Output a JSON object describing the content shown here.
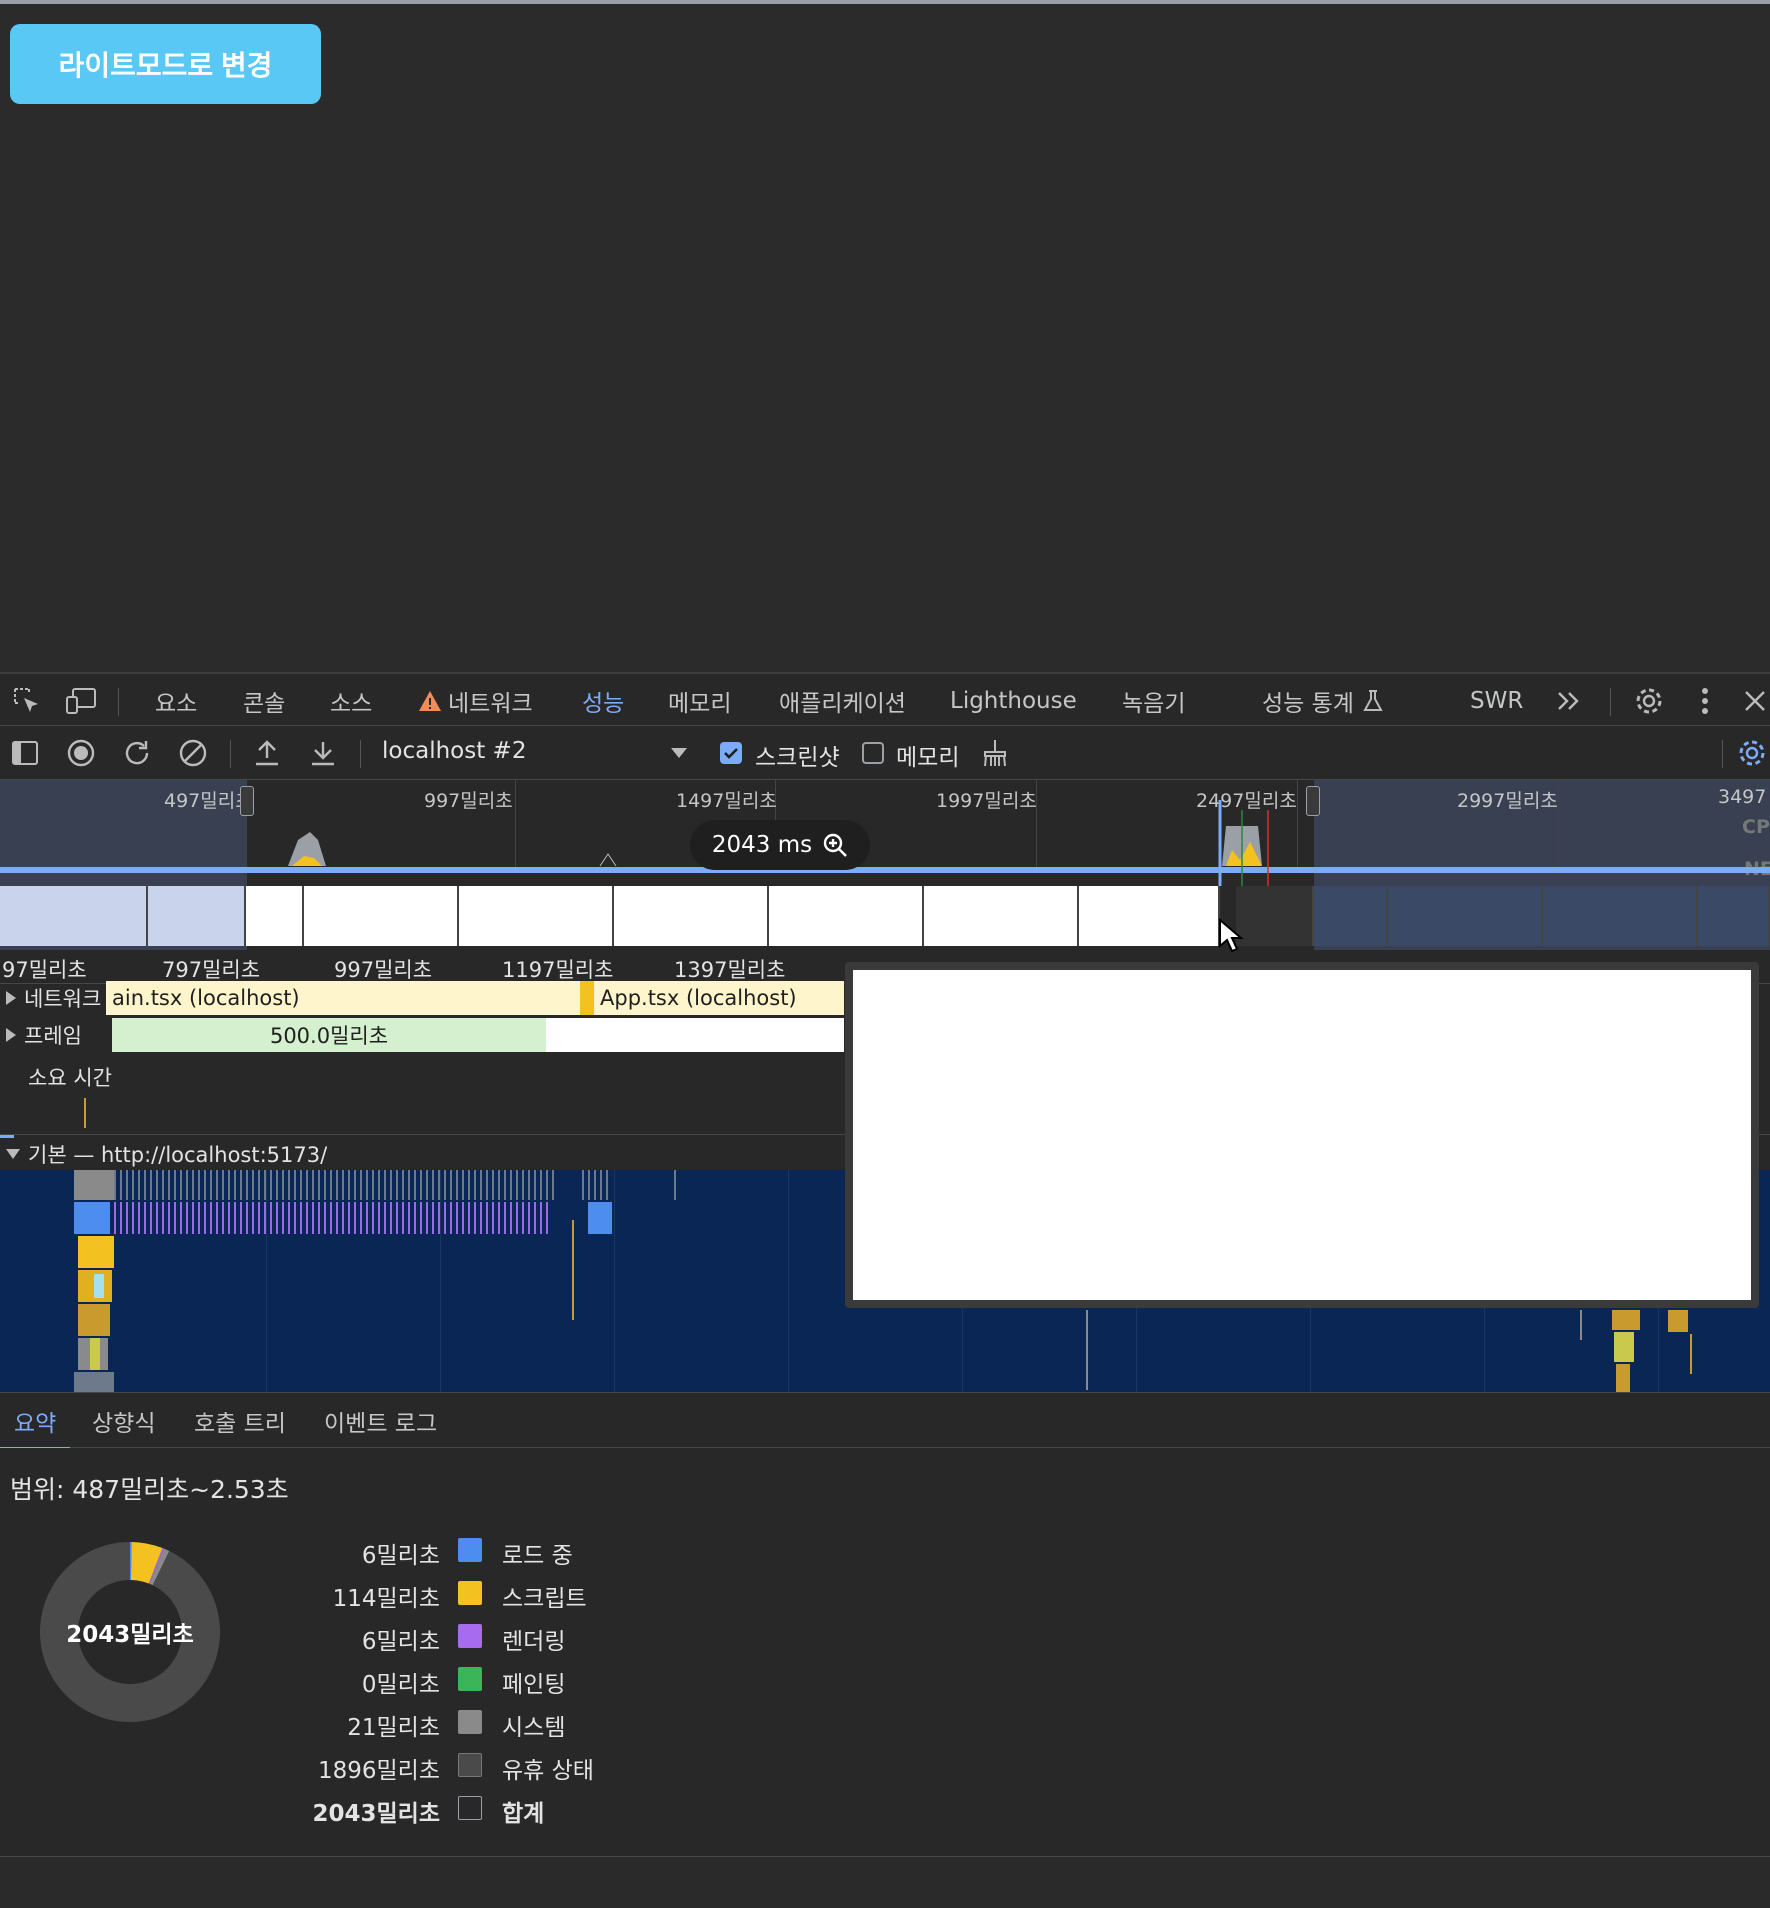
{
  "app": {
    "theme_button": "라이트모드로 변경"
  },
  "devtools": {
    "tabs": [
      {
        "label": "요소"
      },
      {
        "label": "콘솔"
      },
      {
        "label": "소스"
      },
      {
        "label": "네트워크"
      },
      {
        "label": "성능"
      },
      {
        "label": "메모리"
      },
      {
        "label": "애플리케이션"
      },
      {
        "label": "Lighthouse"
      },
      {
        "label": "녹음기"
      },
      {
        "label": "성능 통계"
      },
      {
        "label": "SWR"
      }
    ],
    "active_tab": "성능",
    "accent": "#7cacf8"
  },
  "toolbar": {
    "target": "localhost #2",
    "screenshot_label": "스크린샷",
    "screenshot_checked": true,
    "memory_label": "메모리",
    "memory_checked": false
  },
  "overview": {
    "labels": [
      "497밀리초",
      "997밀리초",
      "1497밀리초",
      "1997밀리초",
      "2497밀리초",
      "2997밀리초",
      "3497"
    ],
    "cpu_label": "CP",
    "net_label": "NE",
    "zoom_chip": "2043 ms"
  },
  "ruler": {
    "labels": [
      "97밀리초",
      "797밀리초",
      "997밀리초",
      "1197밀리초",
      "1397밀리초"
    ]
  },
  "tracks": {
    "network": "네트워크",
    "frames": "프레임",
    "timings": "소요 시간",
    "main": "기본 — http://localhost:5173/",
    "net_bar_1": "ain.tsx (localhost)",
    "net_bar_2": "App.tsx (localhost)",
    "frame_bar": "500.0밀리초"
  },
  "bottom_tabs": [
    {
      "label": "요약"
    },
    {
      "label": "상향식"
    },
    {
      "label": "호출 트리"
    },
    {
      "label": "이벤트 로그"
    }
  ],
  "summary": {
    "range": "범위: 487밀리초~2.53초",
    "total_center": "2043밀리초",
    "rows": [
      {
        "value": "6밀리초",
        "label": "로드 중",
        "color": "#4e8df0"
      },
      {
        "value": "114밀리초",
        "label": "스크립트",
        "color": "#f4c220"
      },
      {
        "value": "6밀리초",
        "label": "렌더링",
        "color": "#a76bf0"
      },
      {
        "value": "0밀리초",
        "label": "페인팅",
        "color": "#3cb55a"
      },
      {
        "value": "21밀리초",
        "label": "시스템",
        "color": "#8a8a8a"
      },
      {
        "value": "1896밀리초",
        "label": "유휴 상태",
        "color": "#4a4a4a"
      },
      {
        "value": "2043밀리초",
        "label": "합계",
        "color": "transparent"
      }
    ]
  }
}
